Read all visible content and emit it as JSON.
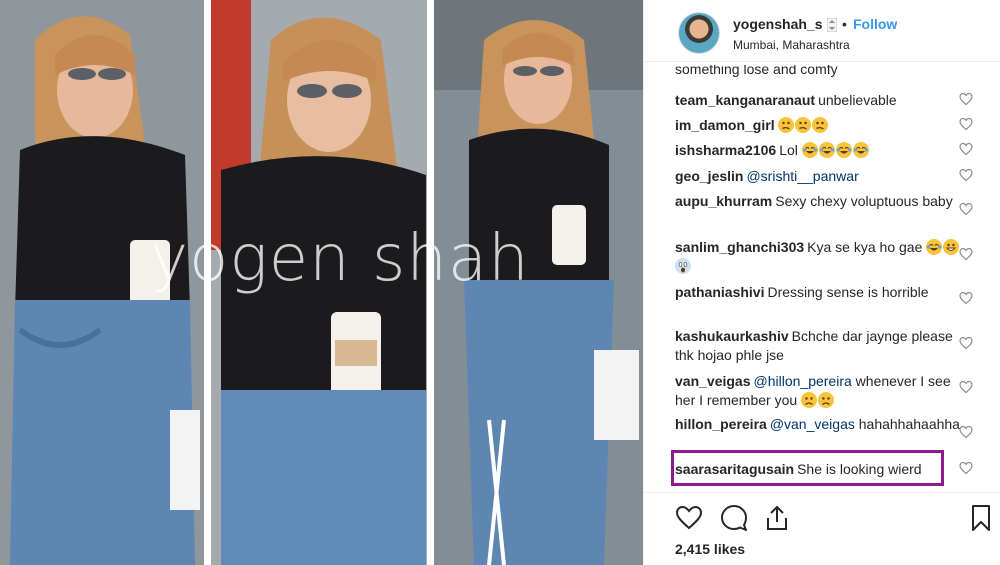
{
  "photo": {
    "watermark": "yogen shah"
  },
  "post": {
    "username": "yogenshah_s",
    "separator": "•",
    "follow_label": "Follow",
    "location": "Mumbai, Maharashtra",
    "truncated_comment": "something lose and comfy",
    "comments": [
      {
        "user": "team_kanganaranaut",
        "text": "unbelievable",
        "emoji": []
      },
      {
        "user": "im_damon_girl",
        "text": "",
        "emoji": [
          "confused",
          "confused",
          "confused"
        ]
      },
      {
        "user": "ishsharma2106",
        "text": "Lol",
        "emoji": [
          "joy",
          "joy",
          "joy",
          "joy"
        ]
      },
      {
        "user": "geo_jeslin",
        "mention": "@srishti__panwar",
        "text": "",
        "emoji": []
      },
      {
        "user": "aupu_khurram",
        "text": "Sexy chexy voluptuous baby",
        "emoji": []
      },
      {
        "user": "sanlim_ghanchi303",
        "text": "Kya se kya ho gae",
        "emoji": [
          "joy",
          "grin",
          "scared"
        ]
      },
      {
        "user": "pathaniashivi",
        "text": "Dressing sense is horrible",
        "emoji": []
      },
      {
        "user": "kashukaurkashiv",
        "text": "Bchche dar jaynge please thk hojao phle jse",
        "emoji": []
      },
      {
        "user": "van_veigas",
        "mention": "@hillon_pereira",
        "text": "whenever I see her I remember you",
        "emoji": [
          "frown",
          "frown"
        ]
      },
      {
        "user": "hillon_pereira",
        "mention": "@van_veigas",
        "text": "hahahhahaahha",
        "emoji": []
      },
      {
        "user": "saarasaritagusain",
        "text": "She is looking wierd",
        "emoji": []
      }
    ],
    "likes": "2,415 likes",
    "highlight_color": "#8e1b8e",
    "follow_color": "#3897f0"
  },
  "icons": {
    "like": "heart-icon",
    "comment": "comment-icon",
    "share": "share-icon",
    "save": "bookmark-icon",
    "verified_toggle": "updown-icon"
  }
}
